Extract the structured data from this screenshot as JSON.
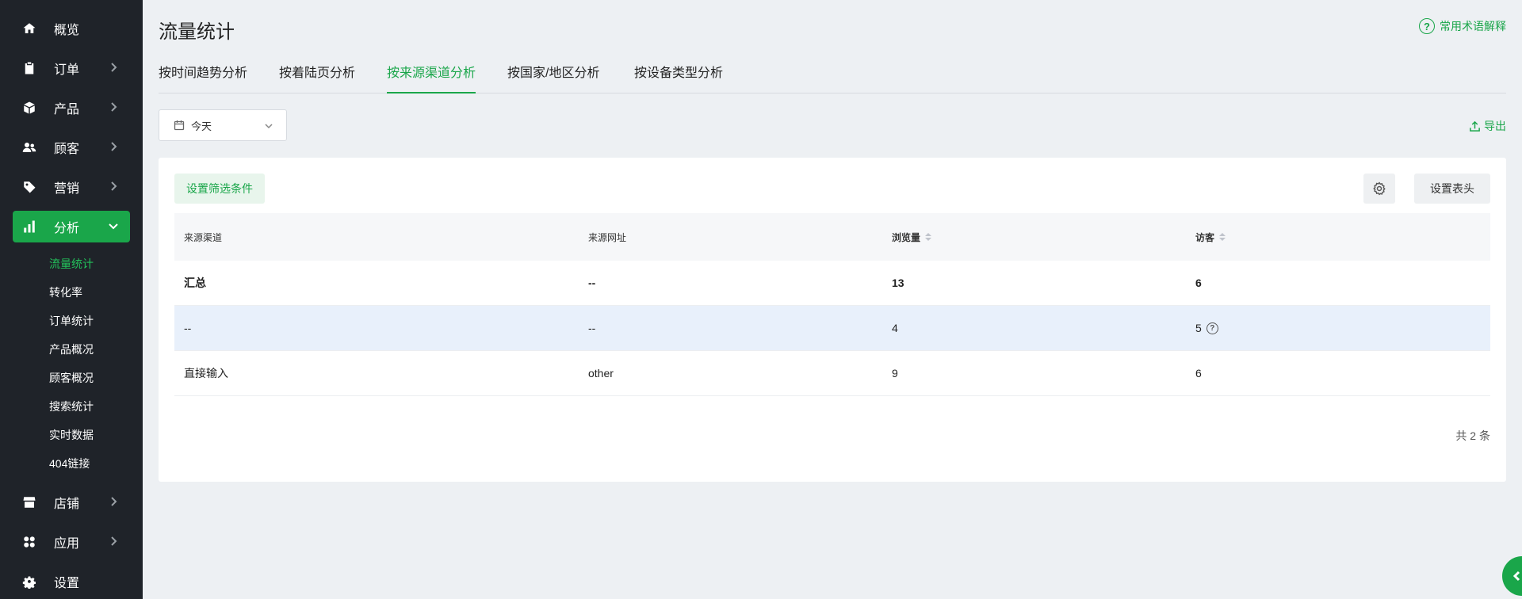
{
  "sidebar": {
    "items": [
      {
        "label": "概览",
        "icon": "home-icon"
      },
      {
        "label": "订单",
        "icon": "clipboard-icon"
      },
      {
        "label": "产品",
        "icon": "box-icon"
      },
      {
        "label": "顾客",
        "icon": "users-icon"
      },
      {
        "label": "营销",
        "icon": "tag-icon"
      },
      {
        "label": "分析",
        "icon": "bar-chart-icon"
      },
      {
        "label": "店铺",
        "icon": "store-icon"
      },
      {
        "label": "应用",
        "icon": "apps-icon"
      },
      {
        "label": "设置",
        "icon": "gear-icon"
      }
    ],
    "sub_items": [
      "流量统计",
      "转化率",
      "订单统计",
      "产品概况",
      "顾客概况",
      "搜索统计",
      "实时数据",
      "404链接"
    ],
    "active_color": "#1aa64a"
  },
  "page": {
    "title": "流量统计",
    "help_label": "常用术语解释"
  },
  "tabs": [
    "按时间趋势分析",
    "按着陆页分析",
    "按来源渠道分析",
    "按国家/地区分析",
    "按设备类型分析"
  ],
  "toolbar": {
    "date_value": "今天",
    "export_label": "导出"
  },
  "card": {
    "filter_label": "设置筛选条件",
    "header_settings_label": "设置表头"
  },
  "table": {
    "columns": [
      "来源渠道",
      "来源网址",
      "浏览量",
      "访客"
    ],
    "summary": [
      "汇总",
      "--",
      "13",
      "6"
    ],
    "rows": [
      [
        "--",
        "--",
        "4",
        "5"
      ],
      [
        "直接输入",
        "other",
        "9",
        "6"
      ]
    ],
    "total_label": "共 2 条"
  }
}
